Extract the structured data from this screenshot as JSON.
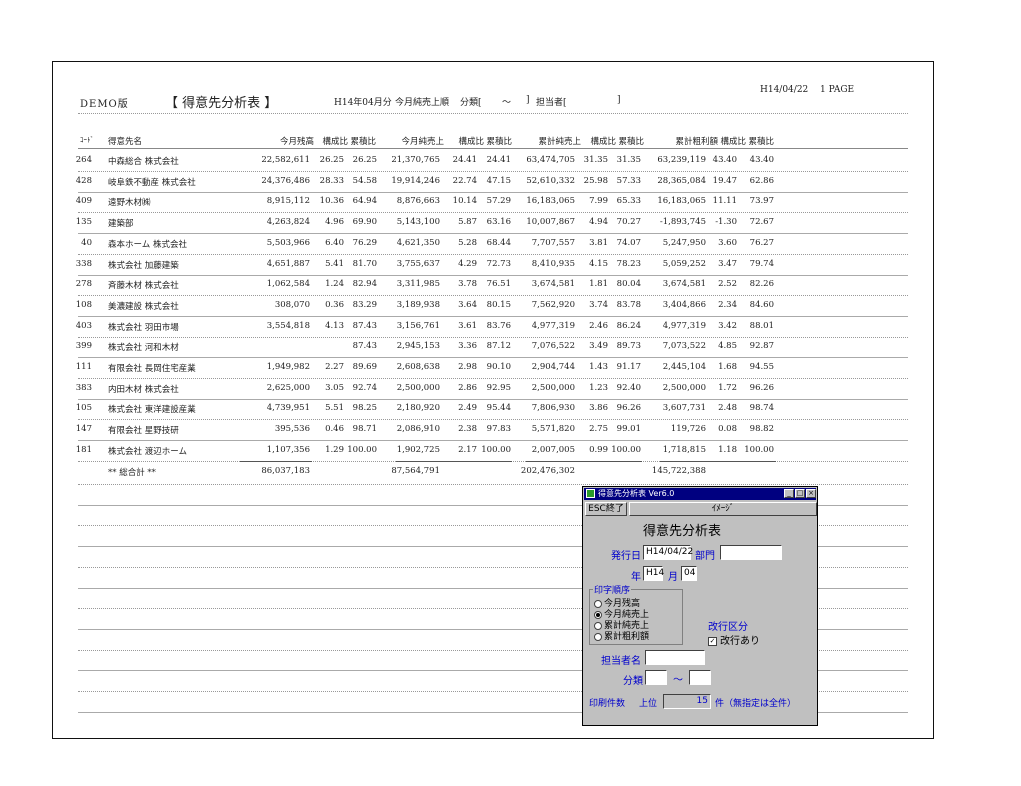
{
  "report": {
    "brand": "DEMO版",
    "title": "【 得意先分析表 】",
    "period": "H14年04月分",
    "order": "今月純売上順",
    "category_label": "分類[",
    "category_tilde": "～",
    "category_close": "]",
    "tanto_label": "担当者[",
    "tanto_close": "]",
    "date": "H14/04/22",
    "page": "1 PAGE"
  },
  "columns": [
    "ｺｰﾄﾞ",
    "得意先名",
    "今月残高",
    "構成比",
    "累積比",
    "今月純売上",
    "構成比",
    "累積比",
    "累計純売上",
    "構成比",
    "累積比",
    "累計粗利額",
    "構成比",
    "累積比"
  ],
  "rows": [
    {
      "code": "264",
      "name": "中森総合 株式会社",
      "bal": "22,582,611",
      "bal_r": "26.25",
      "bal_c": "26.25",
      "sales": "21,370,765",
      "sales_r": "24.41",
      "sales_c": "24.41",
      "cum": "63,474,705",
      "cum_r": "31.35",
      "cum_c": "31.35",
      "gp": "63,239,119",
      "gp_r": "43.40",
      "gp_c": "43.40"
    },
    {
      "code": "428",
      "name": "岐阜鉄不動産 株式会社",
      "bal": "24,376,486",
      "bal_r": "28.33",
      "bal_c": "54.58",
      "sales": "19,914,246",
      "sales_r": "22.74",
      "sales_c": "47.15",
      "cum": "52,610,332",
      "cum_r": "25.98",
      "cum_c": "57.33",
      "gp": "28,365,084",
      "gp_r": "19.47",
      "gp_c": "62.86"
    },
    {
      "code": "409",
      "name": "遠野木材㈱",
      "bal": "8,915,112",
      "bal_r": "10.36",
      "bal_c": "64.94",
      "sales": "8,876,663",
      "sales_r": "10.14",
      "sales_c": "57.29",
      "cum": "16,183,065",
      "cum_r": "7.99",
      "cum_c": "65.33",
      "gp": "16,183,065",
      "gp_r": "11.11",
      "gp_c": "73.97"
    },
    {
      "code": "135",
      "name": "建築部",
      "bal": "4,263,824",
      "bal_r": "4.96",
      "bal_c": "69.90",
      "sales": "5,143,100",
      "sales_r": "5.87",
      "sales_c": "63.16",
      "cum": "10,007,867",
      "cum_r": "4.94",
      "cum_c": "70.27",
      "gp": "-1,893,745",
      "gp_r": "-1.30",
      "gp_c": "72.67"
    },
    {
      "code": "40",
      "name": "森本ホーム 株式会社",
      "bal": "5,503,966",
      "bal_r": "6.40",
      "bal_c": "76.29",
      "sales": "4,621,350",
      "sales_r": "5.28",
      "sales_c": "68.44",
      "cum": "7,707,557",
      "cum_r": "3.81",
      "cum_c": "74.07",
      "gp": "5,247,950",
      "gp_r": "3.60",
      "gp_c": "76.27"
    },
    {
      "code": "338",
      "name": "株式会社 加藤建築",
      "bal": "4,651,887",
      "bal_r": "5.41",
      "bal_c": "81.70",
      "sales": "3,755,637",
      "sales_r": "4.29",
      "sales_c": "72.73",
      "cum": "8,410,935",
      "cum_r": "4.15",
      "cum_c": "78.23",
      "gp": "5,059,252",
      "gp_r": "3.47",
      "gp_c": "79.74"
    },
    {
      "code": "278",
      "name": "斉藤木材 株式会社",
      "bal": "1,062,584",
      "bal_r": "1.24",
      "bal_c": "82.94",
      "sales": "3,311,985",
      "sales_r": "3.78",
      "sales_c": "76.51",
      "cum": "3,674,581",
      "cum_r": "1.81",
      "cum_c": "80.04",
      "gp": "3,674,581",
      "gp_r": "2.52",
      "gp_c": "82.26"
    },
    {
      "code": "108",
      "name": "美濃建設 株式会社",
      "bal": "308,070",
      "bal_r": "0.36",
      "bal_c": "83.29",
      "sales": "3,189,938",
      "sales_r": "3.64",
      "sales_c": "80.15",
      "cum": "7,562,920",
      "cum_r": "3.74",
      "cum_c": "83.78",
      "gp": "3,404,866",
      "gp_r": "2.34",
      "gp_c": "84.60"
    },
    {
      "code": "403",
      "name": "株式会社 羽田市場",
      "bal": "3,554,818",
      "bal_r": "4.13",
      "bal_c": "87.43",
      "sales": "3,156,761",
      "sales_r": "3.61",
      "sales_c": "83.76",
      "cum": "4,977,319",
      "cum_r": "2.46",
      "cum_c": "86.24",
      "gp": "4,977,319",
      "gp_r": "3.42",
      "gp_c": "88.01"
    },
    {
      "code": "399",
      "name": "株式会社 河和木材",
      "bal": "",
      "bal_r": "",
      "bal_c": "87.43",
      "sales": "2,945,153",
      "sales_r": "3.36",
      "sales_c": "87.12",
      "cum": "7,076,522",
      "cum_r": "3.49",
      "cum_c": "89.73",
      "gp": "7,073,522",
      "gp_r": "4.85",
      "gp_c": "92.87"
    },
    {
      "code": "111",
      "name": "有限会社 長岡住宅産業",
      "bal": "1,949,982",
      "bal_r": "2.27",
      "bal_c": "89.69",
      "sales": "2,608,638",
      "sales_r": "2.98",
      "sales_c": "90.10",
      "cum": "2,904,744",
      "cum_r": "1.43",
      "cum_c": "91.17",
      "gp": "2,445,104",
      "gp_r": "1.68",
      "gp_c": "94.55"
    },
    {
      "code": "383",
      "name": "内田木材 株式会社",
      "bal": "2,625,000",
      "bal_r": "3.05",
      "bal_c": "92.74",
      "sales": "2,500,000",
      "sales_r": "2.86",
      "sales_c": "92.95",
      "cum": "2,500,000",
      "cum_r": "1.23",
      "cum_c": "92.40",
      "gp": "2,500,000",
      "gp_r": "1.72",
      "gp_c": "96.26"
    },
    {
      "code": "105",
      "name": "株式会社 東洋建設産業",
      "bal": "4,739,951",
      "bal_r": "5.51",
      "bal_c": "98.25",
      "sales": "2,180,920",
      "sales_r": "2.49",
      "sales_c": "95.44",
      "cum": "7,806,930",
      "cum_r": "3.86",
      "cum_c": "96.26",
      "gp": "3,607,731",
      "gp_r": "2.48",
      "gp_c": "98.74"
    },
    {
      "code": "147",
      "name": "有限会社 星野技研",
      "bal": "395,536",
      "bal_r": "0.46",
      "bal_c": "98.71",
      "sales": "2,086,910",
      "sales_r": "2.38",
      "sales_c": "97.83",
      "cum": "5,571,820",
      "cum_r": "2.75",
      "cum_c": "99.01",
      "gp": "119,726",
      "gp_r": "0.08",
      "gp_c": "98.82"
    },
    {
      "code": "181",
      "name": "株式会社 渡辺ホーム",
      "bal": "1,107,356",
      "bal_r": "1.29",
      "bal_c": "100.00",
      "sales": "1,902,725",
      "sales_r": "2.17",
      "sales_c": "100.00",
      "cum": "2,007,005",
      "cum_r": "0.99",
      "cum_c": "100.00",
      "gp": "1,718,815",
      "gp_r": "1.18",
      "gp_c": "100.00"
    }
  ],
  "total": {
    "label": "** 総合計 **",
    "bal": "86,037,183",
    "sales": "87,564,791",
    "cum": "202,476,302",
    "gp": "145,722,388"
  },
  "dialog": {
    "window_title": "得意先分析表 Ver6.0",
    "esc_button": "ESC終了",
    "image_button": "ｲﾒｰｼﾞ",
    "heading": "得意先分析表",
    "issue_date_label": "発行日",
    "issue_date_value": "H14/04/22",
    "dept_label": "部門",
    "dept_value": "",
    "year_label": "年",
    "year_value": "H14",
    "month_label": "月",
    "month_value": "04",
    "print_order_label": "印字順序",
    "print_order_options": [
      "今月残高",
      "今月純売上",
      "累計純売上",
      "累計粗利額"
    ],
    "selected_option": 1,
    "page_break_label": "改行区分",
    "page_break_check": "改行あり",
    "tanto_label": "担当者名",
    "tanto_value": "",
    "category_label": "分類",
    "category_tilde": "～",
    "print_count_label": "印刷件数",
    "top_label": "上位",
    "top_value": "15",
    "count_suffix": "件（無指定は全件）"
  }
}
